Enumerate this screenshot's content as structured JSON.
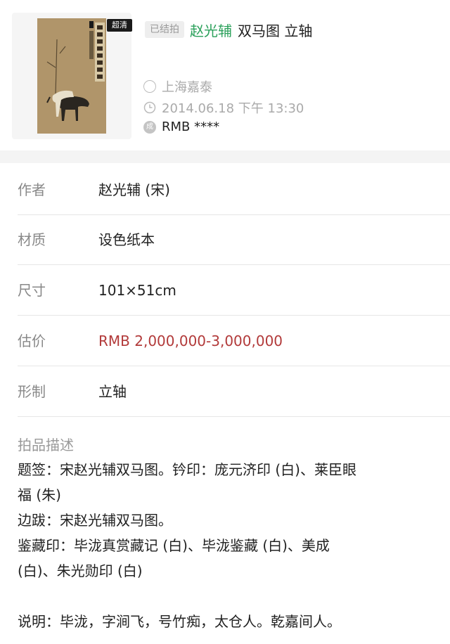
{
  "lot": {
    "image_badge": "超清",
    "status_tag": "已结拍",
    "artist": "赵光辅",
    "work_title": "双马图 立轴",
    "auction_house": "上海嘉泰",
    "datetime": "2014.06.18 下午 13:30",
    "price_icon_text": "成",
    "price": "RMB ****"
  },
  "details": [
    {
      "label": "作者",
      "value": "赵光辅 (宋)"
    },
    {
      "label": "材质",
      "value": "设色纸本"
    },
    {
      "label": "尺寸",
      "value": "101×51cm"
    },
    {
      "label": "估价",
      "value": "RMB  2,000,000-3,000,000"
    },
    {
      "label": "形制",
      "value": "立轴"
    }
  ],
  "description": {
    "title": "拍品描述",
    "lines": [
      "题签：宋赵光辅双马图。钤印：庞元济印 (白)、莱臣眼",
      "福 (朱)",
      "边跋：宋赵光辅双马图。",
      "鉴藏印：毕泷真赏藏记 (白)、毕泷鉴藏 (白)、美成",
      "(白)、朱光勋印 (白)",
      "说明：毕泷，字涧飞，号竹痴，太仓人。乾嘉间人。"
    ]
  },
  "colors": {
    "artist_green": "#2aa05a",
    "estimate_red": "#b23a3a",
    "label_gray": "#888888"
  }
}
